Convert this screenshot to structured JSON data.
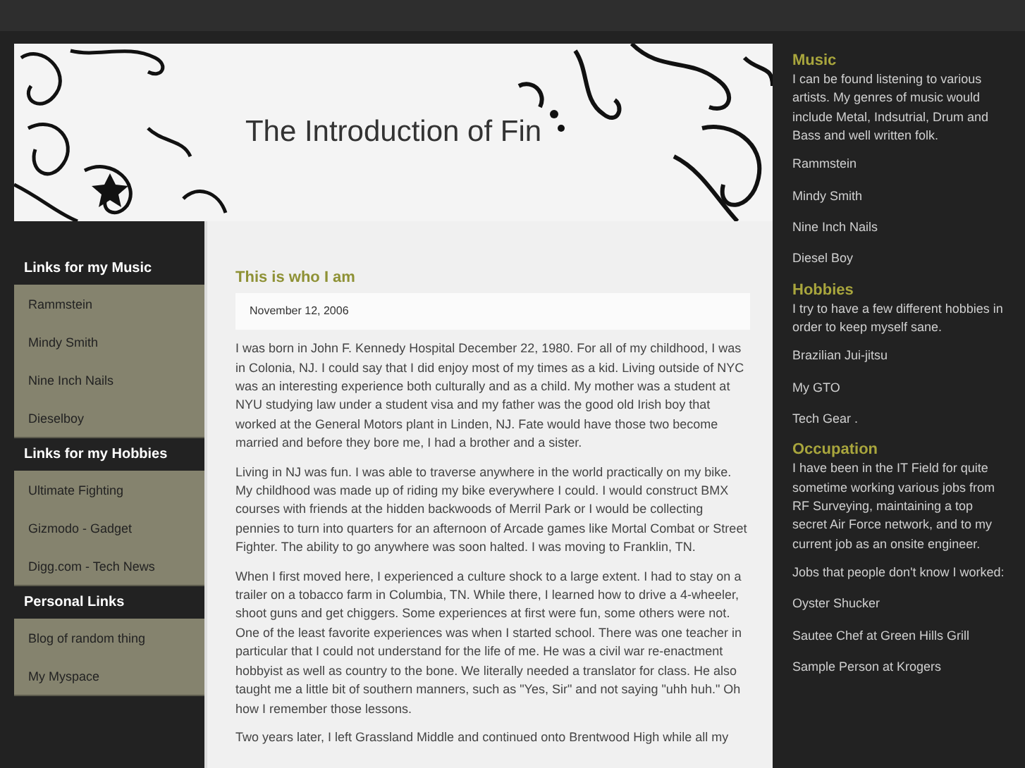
{
  "header": {
    "title": "The Introduction of Fin"
  },
  "left_sidebar": {
    "sections": [
      {
        "heading": "Links for my Music",
        "links": [
          "Rammstein",
          "Mindy Smith",
          "Nine Inch Nails",
          "Dieselboy"
        ]
      },
      {
        "heading": "Links for my Hobbies",
        "links": [
          "Ultimate Fighting",
          "Gizmodo - Gadget",
          "Digg.com - Tech News"
        ]
      },
      {
        "heading": "Personal Links",
        "links": [
          "Blog of random thing",
          "My Myspace"
        ]
      }
    ]
  },
  "post": {
    "title": "This is who I am",
    "date": "November 12, 2006",
    "paragraphs": [
      "I was born in John F. Kennedy Hospital December 22, 1980. For all of my childhood, I was in Colonia, NJ. I could say that I did enjoy most of my times as a kid. Living outside of NYC was an interesting experience both culturally and as a child. My mother was a student at NYU studying law under a student visa and my father was the good old Irish boy that worked at the General Motors plant in Linden, NJ. Fate would have those two become married and before they bore me, I had a brother and a sister.",
      "Living in NJ was fun. I was able to traverse anywhere in the world practically on my bike. My childhood was made up of riding my bike everywhere I could. I would construct BMX courses with friends at the hidden backwoods of Merril Park or I would be collecting pennies to turn into quarters for an afternoon of Arcade games like Mortal Combat or Street Fighter. The ability to go anywhere was soon halted. I was moving to Franklin, TN.",
      "When I first moved here, I experienced a culture shock to a large extent. I had to stay on a trailer on a tobacco farm in Columbia, TN. While there, I learned how to drive a 4-wheeler, shoot guns and get chiggers. Some experiences at first were fun, some others were not. One of the least favorite experiences was when I started school. There was one teacher in particular that I could not understand for the life of me. He was a civil war re-enactment hobbyist as well as country to the bone. We literally needed a translator for class. He also taught me a little bit of southern manners, such as \"Yes, Sir\" and not saying \"uhh huh.\" Oh how I remember those lessons.",
      "Two years later, I left Grassland Middle and continued onto Brentwood High while all my"
    ]
  },
  "right_sidebar": {
    "sections": [
      {
        "heading": "Music",
        "description": "I can be found listening to various artists. My genres of music would include Metal, Indsutrial, Drum and Bass and well written folk.",
        "items": [
          "Rammstein",
          "Mindy Smith",
          "Nine Inch Nails",
          "Diesel Boy"
        ]
      },
      {
        "heading": "Hobbies",
        "description": "I try to have a few different hobbies in order to keep myself sane.",
        "items": [
          "Brazilian Jui-jitsu",
          "My GTO",
          "Tech Gear ."
        ]
      },
      {
        "heading": "Occupation",
        "description": "I have been in the IT Field for quite sometime working various jobs from RF Surveying, maintaining a top secret Air Force network, and to my current job as an onsite engineer.",
        "items": [
          "Jobs that people don't know I worked:",
          "Oyster Shucker",
          "Sautee Chef at Green Hills Grill",
          "Sample Person at Krogers"
        ]
      }
    ]
  }
}
